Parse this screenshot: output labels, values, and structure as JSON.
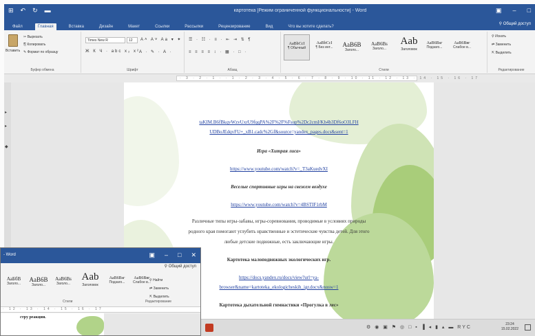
{
  "back_window": {
    "quick_access": [
      "⊞",
      "↶",
      "↻",
      "▬"
    ],
    "title": "картотека [Режим ограниченной функциональности] - Word",
    "controls": [
      "▣",
      "–",
      "□"
    ],
    "tabs": [
      "Файл",
      "Главная",
      "Вставка",
      "Дизайн",
      "Макет",
      "Ссылки",
      "Рассылки",
      "Рецензирование",
      "Вид",
      "Что вы хотите сделать?"
    ],
    "active_tab_index": 1,
    "share": "Общий доступ"
  },
  "ribbon": {
    "clipboard": {
      "paste": "Вставить",
      "cut": "Вырезать",
      "copy": "Копировать",
      "format_painter": "Формат по образцу",
      "group": "Буфер обмена"
    },
    "font": {
      "name": "Times New R",
      "size": "12",
      "row1": "A˄ A˅ Aa ▾ ✦",
      "row2": "Ж К Ч · abc x₂ x²",
      "row3": "A · ✎ · A ·",
      "group": "Шрифт"
    },
    "paragraph": {
      "row1": "☰ · ☷ · ≡ · ⇤ ⇥ ⇅ ¶",
      "row2": "≡ ≡ ≡ ≡ ↕ · ▦ · □ ·",
      "group": "Абзац"
    },
    "styles": [
      {
        "preview": "AaBbCcI",
        "name": "¶ Обычный"
      },
      {
        "preview": "AaBbCcI",
        "name": "¶ Без инт..."
      },
      {
        "preview": "AaB6B",
        "name": "Заголо..."
      },
      {
        "preview": "AaB6Bs",
        "name": "Заголо..."
      },
      {
        "preview": "Aab",
        "name": "Заголовок"
      },
      {
        "preview": "AaB6Bsг",
        "name": "Подзаго..."
      },
      {
        "preview": "AaB6Bвг",
        "name": "Слабое в..."
      }
    ],
    "styles_group": "Стили",
    "editing": {
      "find": "Искать",
      "replace": "Заменить",
      "select": "Выделить",
      "group": "Редактирование"
    }
  },
  "ruler_ticks": "· 3 · 2 · 1 · · 1 · 2 · 3 · 4 · 5 · 6 · 7 · 8 · 9 · 10 · 11 · 12 · 13 · 14 · 15 · 16 · 17",
  "left_strip": [
    "▸",
    "▸",
    "◆"
  ],
  "document": {
    "lines": [
      {
        "text": "taKIM.B6fBkqvWzvUxrU9fqqPA%2F%2F%Fsup%2Dc2cmI/Kh4b3Df6oO3LFH",
        "style": "link"
      },
      {
        "text": "UDBoJEdqvFU+_xB1.cadc%2Gf&source=yandex_pages.docs&sent=1",
        "style": "link"
      },
      {
        "text": "Игра «Хитрая лиса»",
        "style": "bi"
      },
      {
        "text": "https://www.youtube.com/watch?v=_T3aKuedvXI",
        "style": "link"
      },
      {
        "text": "Веселые спортивные игры на свежем воздухе",
        "style": "bi"
      },
      {
        "text": "https://www.youtube.com/watch?v=4BSTIF1rbM",
        "style": "link"
      },
      {
        "text": "Различные типы игры-забавы, игры-соревнования, проводимые в условиях природы",
        "style": "p"
      },
      {
        "text": "родного края помогают углубить нравственные и эстетические чувства детей. Для этого",
        "style": "p"
      },
      {
        "text": "любые детские подвижные, есть заключающие игры.",
        "style": "p"
      },
      {
        "text": "Картотека малоподвижных экологических игр.",
        "style": "b"
      },
      {
        "text": "https://docs.yandex.ru/docs/view?url=ya-",
        "style": "link"
      },
      {
        "text": "browser&name=kartoteka_ekologicheskih_igr.docx&nosw=1",
        "style": "link"
      },
      {
        "text": "Картотека дыхательной гимнастики «Прогулка в лес»",
        "style": "b"
      }
    ]
  },
  "front_window": {
    "title": "- Word",
    "controls": [
      "▣",
      "–",
      "□",
      "✕"
    ],
    "share": "Общий доступ",
    "styles": [
      {
        "preview": "АаБбВ",
        "name": "Заголо..."
      },
      {
        "preview": "AaB6B",
        "name": "Заголо..."
      },
      {
        "preview": "AaB6Bs",
        "name": "Заголо..."
      },
      {
        "preview": "Aab",
        "name": "Заголовок"
      },
      {
        "preview": "AaB6Bsг",
        "name": "Подзаго..."
      },
      {
        "preview": "AaB6Bвг",
        "name": "Слабое в..."
      }
    ],
    "styles_group": "Стили",
    "edit_group": "Редактирование",
    "find": "Найти",
    "replace": "Заменить",
    "select": "Выделить",
    "ruler": "· 12 · 13 · 14 · 15 · 16 · 17",
    "page_text": "стру реакции."
  },
  "taskbar": {
    "tray": "⚙ ◉ ▣ ⚑ ◎ □ ▪ ▐ ◂ ▮ ▴ ▬ RYC",
    "time": "23:24",
    "date": "15.02.2022"
  }
}
